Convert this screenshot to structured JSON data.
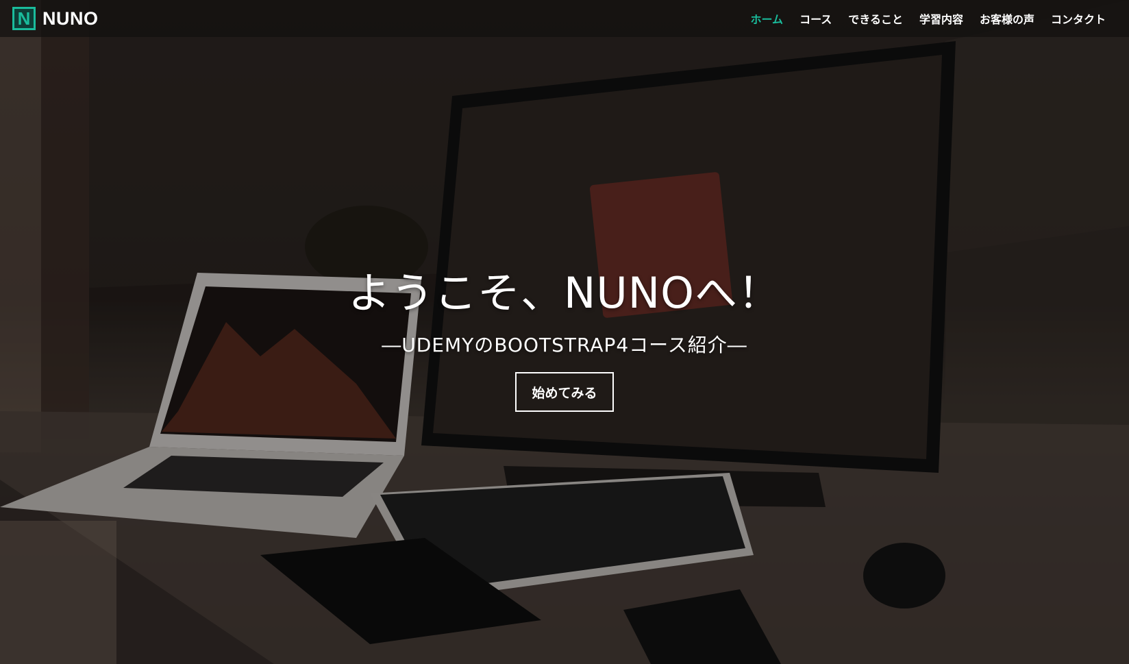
{
  "navbar": {
    "brand_logo_letter": "N",
    "brand_name": "NUNO",
    "items": [
      {
        "label": "ホーム",
        "active": true
      },
      {
        "label": "コース",
        "active": false
      },
      {
        "label": "できること",
        "active": false
      },
      {
        "label": "学習内容",
        "active": false
      },
      {
        "label": "お客様の声",
        "active": false
      },
      {
        "label": "コンタクト",
        "active": false
      }
    ]
  },
  "hero": {
    "title": "ようこそ、NUNOへ！",
    "subtitle": "―UDEMYのBOOTSTRAP4コース紹介―",
    "button_label": "始めてみる"
  },
  "colors": {
    "accent": "#1abc9c",
    "text": "#ffffff",
    "navbar_bg": "#12100f"
  }
}
